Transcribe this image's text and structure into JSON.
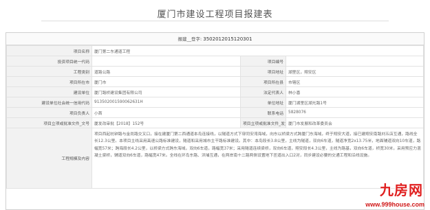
{
  "page": {
    "title": "厦门市建设工程项目报建表"
  },
  "registration": {
    "label": "报建__登字:",
    "number": "3502012015120301"
  },
  "rows": {
    "project_name": {
      "label": "项目名称",
      "value": "厦门第二东通道工程"
    },
    "investment_code": {
      "label": "投资项目统一代码",
      "value": ""
    },
    "project_no": {
      "label": "项目编号",
      "value": ""
    },
    "project_type": {
      "label": "工程类别",
      "value": "道路公路"
    },
    "project_location": {
      "label": "项目地址",
      "value": "湖里区，翔安区"
    },
    "city": {
      "label": "项目所在市",
      "value": "厦门市"
    },
    "district": {
      "label": "项目所在县",
      "value": "市辖区"
    },
    "builder": {
      "label": "建设单位",
      "value": "厦门路桥建设集团有限公司"
    },
    "legal_rep": {
      "label": "法定代表人",
      "value": "林小喜"
    },
    "credit_code": {
      "label": "建设单位社会统一信用代码",
      "value": "913502001590062631H"
    },
    "unit_address": {
      "label": "单位地址",
      "value": "厦门湖里区湖光路1号"
    },
    "principal": {
      "label": "项目负责人",
      "value": "小首"
    },
    "phone": {
      "label": "联系电话",
      "value": "5828076"
    },
    "approval_doc": {
      "label": "项目立项或批准文件_文号",
      "value": "厦发改审批【2018】152号"
    },
    "approval_org": {
      "label": "项目立项或批准文件_发文单位",
      "value": "厦门市发展和改革委员会"
    },
    "scope": {
      "label": "工程规模及内容",
      "value": "项目西起枋钟路与金尚路交叉口，接在建厦门第二西通道本岛连接线，以隧道方式下穿同安湾海域，向东以桥梁方式跨厦门东海域，终于翔安大道，接已建翔安南路刘五店互通，路线全长12.3公里。本项目主线采用高速公路标准建设，隧道和采用城市主干路标准建设。其中：本岛段长3.8公里，主线为隧道，双向6车道，隧道净宽2x13.75米，地面辅道双向10车道，路幅宽57米；跨海段长4.2公里，以桥梁方式跨东海域，双向6车道，路幅宽37米；采用隧道连续梁桥，双向6车道，翔安段长4.3公里，主线为路基，双向6车道，桥宽30米，采用预应力混凝土梁桥，辅道双向6车道，路幅宽47米。全线在环岛东路、洪埔互通，在两岸南十二路两侧设置地下匝道出入口2对，同步建设必要的交通工程和沿线设施。"
    }
  },
  "watermark": {
    "logo": "九房网",
    "url": "www.999house.com"
  },
  "colors": {
    "label_bg": "#f2f2f2",
    "watermark": "#e02020"
  }
}
